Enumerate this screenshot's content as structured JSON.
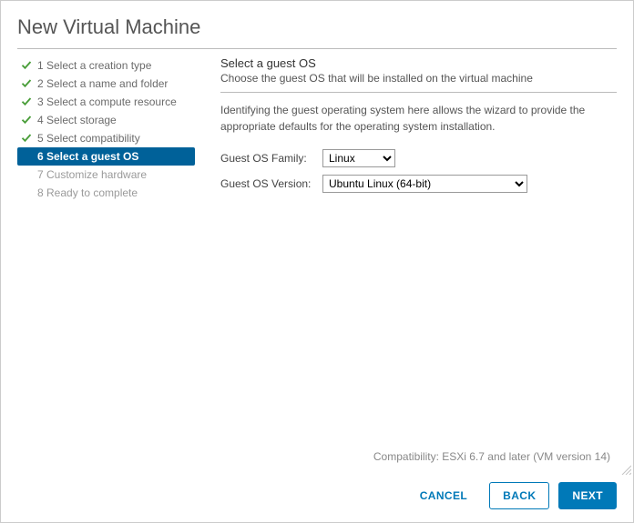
{
  "dialog": {
    "title": "New Virtual Machine"
  },
  "steps": [
    {
      "label": "1 Select a creation type",
      "state": "completed"
    },
    {
      "label": "2 Select a name and folder",
      "state": "completed"
    },
    {
      "label": "3 Select a compute resource",
      "state": "completed"
    },
    {
      "label": "4 Select storage",
      "state": "completed"
    },
    {
      "label": "5 Select compatibility",
      "state": "completed"
    },
    {
      "label": "6 Select a guest OS",
      "state": "current"
    },
    {
      "label": "7 Customize hardware",
      "state": "pending"
    },
    {
      "label": "8 Ready to complete",
      "state": "pending"
    }
  ],
  "section": {
    "title": "Select a guest OS",
    "subtitle": "Choose the guest OS that will be installed on the virtual machine",
    "description": "Identifying the guest operating system here allows the wizard to provide the appropriate defaults for the operating system installation."
  },
  "form": {
    "family_label": "Guest OS Family:",
    "family_value": "Linux",
    "version_label": "Guest OS Version:",
    "version_value": "Ubuntu Linux (64-bit)"
  },
  "footer": {
    "compat": "Compatibility: ESXi 6.7 and later (VM version 14)",
    "cancel": "CANCEL",
    "back": "BACK",
    "next": "NEXT"
  }
}
